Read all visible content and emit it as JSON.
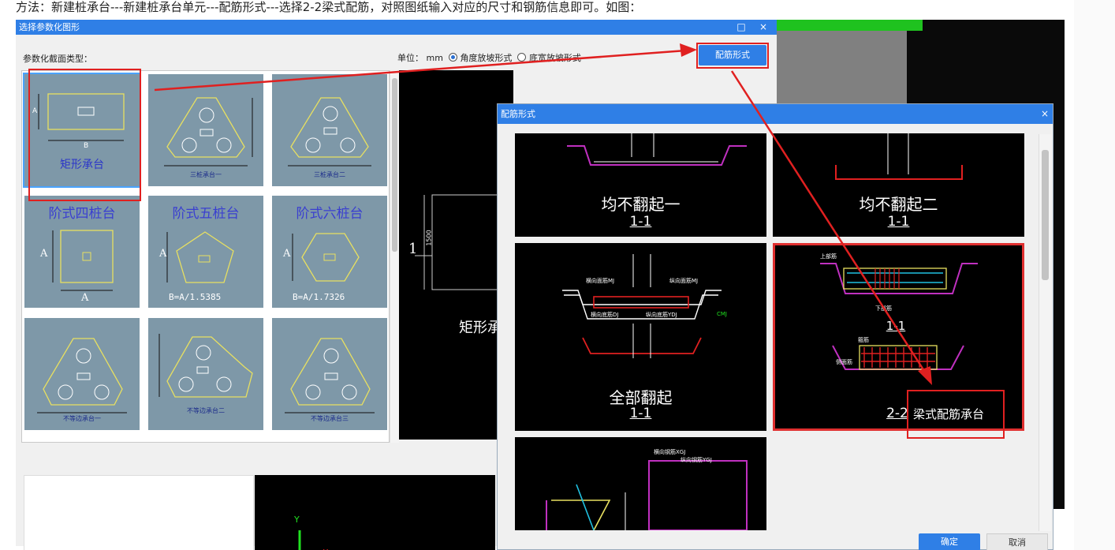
{
  "intro_text": "方法：新建桩承台---新建桩承台单元---配筋形式---选择2-2梁式配筋，对照图纸输入对应的尺寸和钢筋信息即可。如图：",
  "window1": {
    "title": "选择参数化图形",
    "section_label": "参数化截面类型：",
    "unit_label": "单位：",
    "unit_value": "mm",
    "radio_angle": "角度放坡形式",
    "radio_width": "底宽放坡形式",
    "rebar_button": "配筋形式",
    "win_controls": [
      "□",
      "×"
    ],
    "shapes": [
      {
        "label": "矩形承台",
        "dim_a": "A",
        "dim_b": "B"
      },
      {
        "label": "三桩承台一"
      },
      {
        "label": "三桩承台二"
      },
      {
        "label": "阶式四桩台",
        "dim_a": "A",
        "dim_b": "A"
      },
      {
        "label": "阶式五桩台",
        "dim_a": "A",
        "dim_b": "B=A/1.5385"
      },
      {
        "label": "阶式六桩台",
        "dim_a": "A",
        "dim_b": "B=A/1.7326"
      },
      {
        "label": "不等边承台一"
      },
      {
        "label": "不等边承台二"
      },
      {
        "label": "不等边承台三"
      }
    ],
    "preview_label": "矩形承",
    "preview_marker": "1",
    "preview_dim": "1500",
    "axis_y": "Y",
    "axis_x": "X"
  },
  "dialog": {
    "title": "配筋形式",
    "close": "×",
    "panels": [
      {
        "title": "均不翻起一",
        "section": "1-1"
      },
      {
        "title": "均不翻起二",
        "section": "1-1"
      },
      {
        "title": "全部翻起",
        "section": "1-1",
        "labels": [
          "横向面筋MJ",
          "纵向面筋MJ",
          "横向底筋DJ",
          "纵向底筋YDJ",
          "CMJ"
        ]
      },
      {
        "title": "梁式配筋承台",
        "section": "2-2",
        "section_upper": "1-1",
        "labels": [
          "上部筋",
          "下部筋",
          "箍筋",
          "侧面筋"
        ]
      },
      {
        "title": "",
        "labels": [
          "横向钢筋XGJ",
          "纵向钢筋YGJ"
        ]
      }
    ],
    "ok_button": "确定",
    "cancel_button": "取消"
  },
  "annotation": {
    "text": "梁式配筋承台",
    "color": "#e02020"
  }
}
